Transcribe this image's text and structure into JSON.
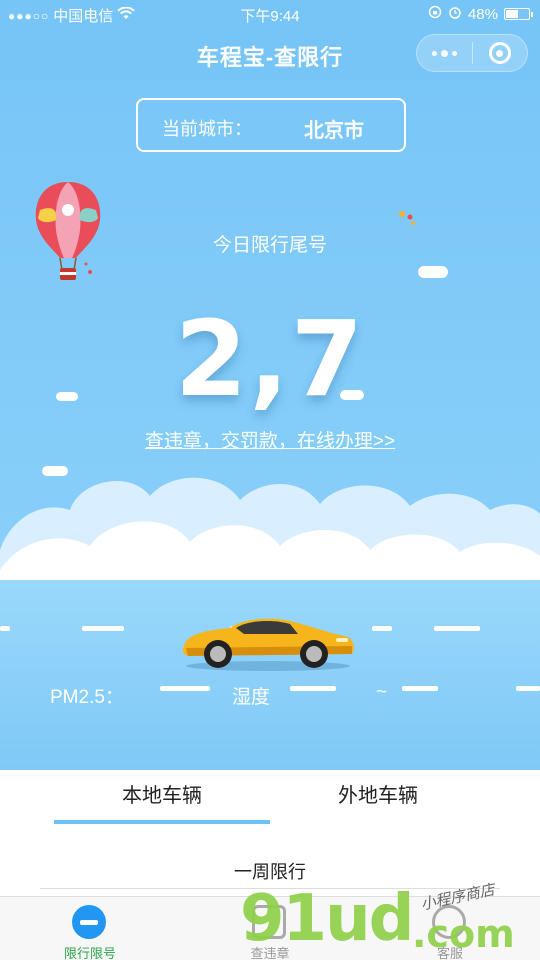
{
  "status_bar": {
    "carrier": "中国电信",
    "time": "下午9:44",
    "battery": "48%",
    "battery_level": 0.48
  },
  "nav": {
    "title": "车程宝-查限行"
  },
  "city": {
    "label": "当前城市：",
    "value": "北京市"
  },
  "restriction": {
    "title": "今日限行尾号",
    "numbers": "2,7",
    "link": "查违章，交罚款，在线办理>>"
  },
  "env": {
    "pm25_label": "PM2.5：",
    "humidity_label": "湿度",
    "humidity_value": "~"
  },
  "tabs": [
    {
      "label": "本地车辆",
      "active": true
    },
    {
      "label": "外地车辆",
      "active": false
    }
  ],
  "week": {
    "title": "一周限行"
  },
  "tabbar": [
    {
      "label": "限行限号",
      "icon": "minus-circle-icon",
      "active": true
    },
    {
      "label": "查违章",
      "icon": "car-icon",
      "active": false
    },
    {
      "label": "客服",
      "icon": "service-icon",
      "active": false
    }
  ],
  "watermark": {
    "main": "91ud",
    "suffix": ".com",
    "small": "小程序商店"
  },
  "colors": {
    "sky": "#79c6f8",
    "tab_indicator": "#6cc2f7",
    "active_tab_label": "#2aa54b",
    "watermark": "#8ed04a"
  }
}
